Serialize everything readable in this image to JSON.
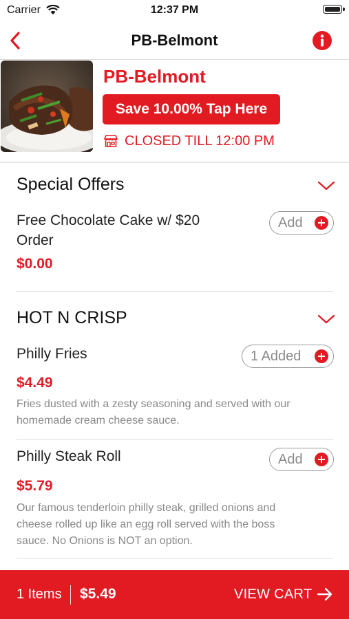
{
  "status_bar": {
    "carrier": "Carrier",
    "time": "12:37 PM"
  },
  "nav": {
    "title": "PB-Belmont",
    "back_icon": "chevron-left-icon",
    "info_icon": "info-icon"
  },
  "restaurant": {
    "name": "PB-Belmont",
    "promo_label": "Save 10.00% Tap Here",
    "status_text": "CLOSED TILL 12:00 PM",
    "status_icon": "storefront-icon",
    "image": "plated-steak-dish-photo"
  },
  "sections": [
    {
      "title": "Special Offers",
      "items": [
        {
          "name_line1": "Free Chocolate Cake w/ $20",
          "name_line2": "Order",
          "price": "$0.00",
          "button_label": "Add"
        }
      ]
    },
    {
      "title": "HOT N CRISP",
      "items": [
        {
          "name": "Philly Fries",
          "price": "$4.49",
          "button_label": "1 Added",
          "desc_line1": "Fries dusted with a zesty seasoning and served with our",
          "desc_line2": "homemade cream cheese sauce."
        },
        {
          "name": "Philly Steak Roll",
          "price": "$5.79",
          "button_label": "Add",
          "desc_line1": "Our famous tenderloin philly steak, grilled onions and",
          "desc_line2": "cheese rolled up like an egg roll served with the boss",
          "desc_line3": "sauce. No Onions is NOT an option."
        }
      ]
    }
  ],
  "cart": {
    "items_label": "1 Items",
    "total": "$5.49",
    "view_cart_label": "VIEW CART"
  },
  "colors": {
    "accent": "#e21b23",
    "muted_text": "#888888",
    "divider": "#dddddd"
  }
}
